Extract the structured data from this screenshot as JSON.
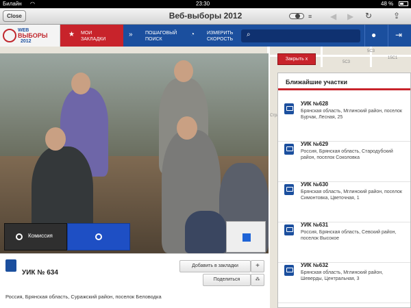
{
  "statusbar": {
    "carrier": "Билайн",
    "time": "23:30",
    "battery": "48 %"
  },
  "browser": {
    "close_label": "Close",
    "title": "Веб-выборы 2012"
  },
  "header": {
    "logo_line1": "WEB",
    "logo_line2": "ВЫБОРЫ",
    "logo_line3": "2012",
    "bookmarks_line1": "МОИ",
    "bookmarks_line2": "ЗАКЛАДКИ",
    "search_line1": "ПОШАГОВЫЙ",
    "search_line2": "ПОИСК",
    "speed_line1": "ИЗМЕРИТЬ",
    "speed_line2": "СКОРОСТЬ"
  },
  "map": {
    "labels": [
      "5С3",
      "15С1",
      "5С3",
      "Стра"
    ]
  },
  "video": {
    "close_label": "Закрыть x",
    "commission_label": "Комиссия"
  },
  "info": {
    "uik_title": "УИК № 634",
    "bookmark_label": "Добавить в закладки",
    "share_label": "Поделиться",
    "plus_symbol": "+",
    "address": "Россия, Брянская область, Суражский район, поселок Беловодка"
  },
  "stations": {
    "title": "Ближайшие участки",
    "items": [
      {
        "name": "УИК №628",
        "address": "Брянская область, Мглинский район, поселок Бурчак, Лесная, 25"
      },
      {
        "name": "УИК №629",
        "address": "Россия, Брянская область, Стародубский район, поселок Соколовка"
      },
      {
        "name": "УИК №630",
        "address": "Брянская область, Мглинский район, поселок Симонтовка, Цветочная, 1"
      },
      {
        "name": "УИК №631",
        "address": "Россия, Брянская область, Севский район, поселок Высокое"
      },
      {
        "name": "УИК №632",
        "address": "Брянская область, Мглинский район, Шеверды, Центральная, 3"
      }
    ]
  }
}
